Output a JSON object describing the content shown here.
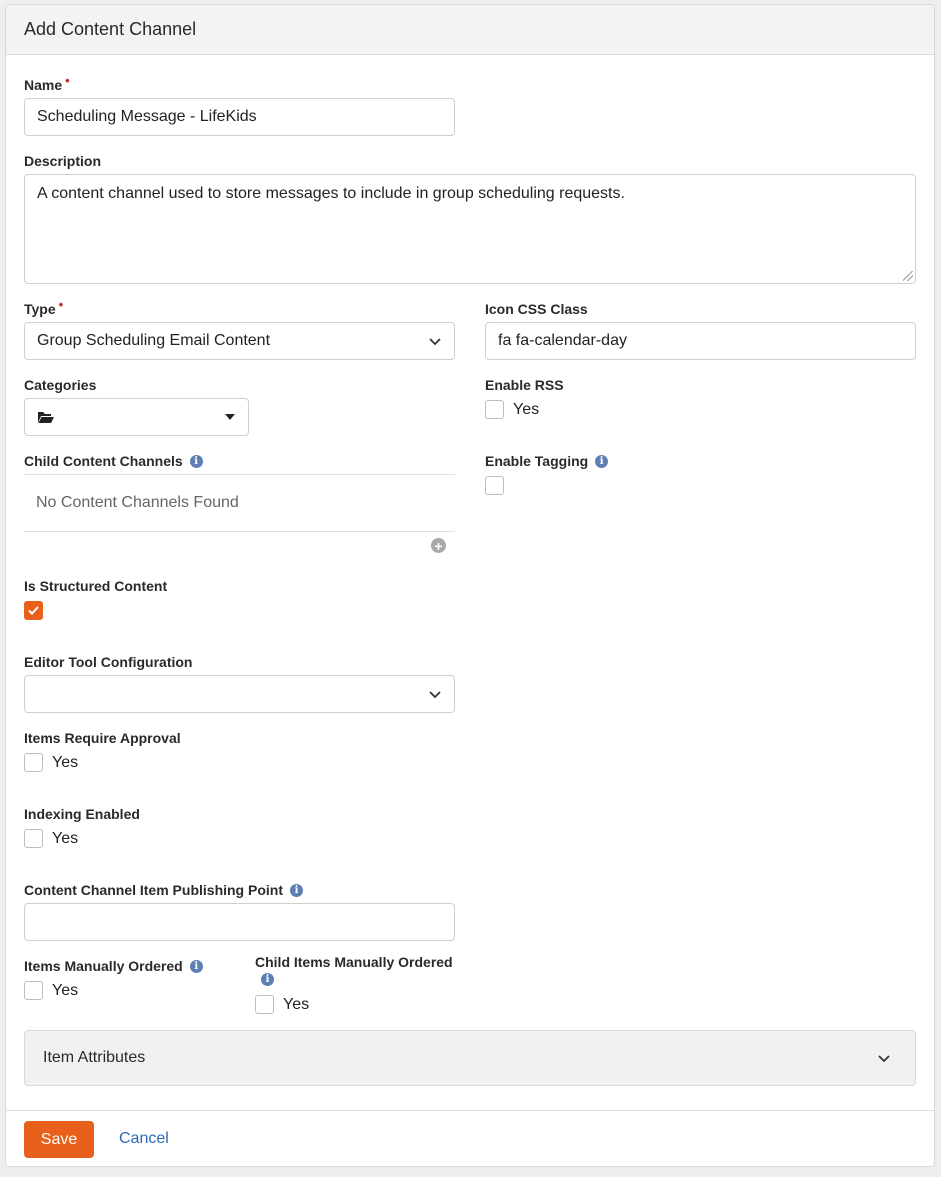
{
  "panel": {
    "title": "Add Content Channel"
  },
  "name": {
    "label": "Name",
    "required_mark": "•",
    "value": "Scheduling Message - LifeKids"
  },
  "description": {
    "label": "Description",
    "value": "A content channel used to store messages to include in group scheduling requests."
  },
  "type": {
    "label": "Type",
    "required_mark": "•",
    "value": "Group Scheduling Email Content"
  },
  "icon_css_class": {
    "label": "Icon CSS Class",
    "value": "fa fa-calendar-day"
  },
  "categories": {
    "label": "Categories",
    "value": ""
  },
  "enable_rss": {
    "label": "Enable RSS",
    "option": "Yes",
    "checked": false
  },
  "child_content_channels": {
    "label": "Child Content Channels",
    "empty_text": "No Content Channels Found"
  },
  "enable_tagging": {
    "label": "Enable Tagging",
    "checked": false
  },
  "is_structured_content": {
    "label": "Is Structured Content",
    "checked": true
  },
  "editor_tool_configuration": {
    "label": "Editor Tool Configuration",
    "value": ""
  },
  "items_require_approval": {
    "label": "Items Require Approval",
    "option": "Yes",
    "checked": false
  },
  "indexing_enabled": {
    "label": "Indexing Enabled",
    "option": "Yes",
    "checked": false
  },
  "publishing_point": {
    "label": "Content Channel Item Publishing Point",
    "value": ""
  },
  "items_manually_ordered": {
    "label": "Items Manually Ordered",
    "option": "Yes",
    "checked": false
  },
  "child_items_manually_ordered": {
    "label": "Child Items Manually Ordered",
    "option": "Yes",
    "checked": false
  },
  "item_attributes": {
    "label": "Item Attributes"
  },
  "actions": {
    "save_label": "Save",
    "cancel_label": "Cancel"
  },
  "icons": {
    "info": "info-circle-icon",
    "chevron": "chevron-down-icon",
    "caret": "caret-down-icon",
    "folder": "folder-open-icon",
    "add": "plus-circle-icon",
    "check": "check-icon"
  },
  "colors": {
    "accent": "#e8601c",
    "link": "#2d6bb8",
    "required": "#c9302c",
    "info_icon": "#5d7fb5"
  }
}
